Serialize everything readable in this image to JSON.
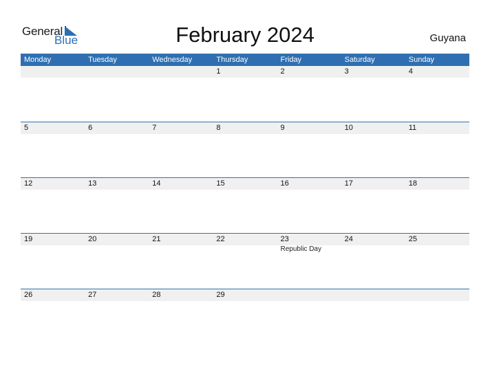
{
  "logo": {
    "line1": "General",
    "line2": "Blue"
  },
  "title": "February 2024",
  "country": "Guyana",
  "weekdays": [
    "Monday",
    "Tuesday",
    "Wednesday",
    "Thursday",
    "Friday",
    "Saturday",
    "Sunday"
  ],
  "weeks": [
    {
      "days": [
        {
          "d": "",
          "h": ""
        },
        {
          "d": "",
          "h": ""
        },
        {
          "d": "",
          "h": ""
        },
        {
          "d": "1",
          "h": ""
        },
        {
          "d": "2",
          "h": ""
        },
        {
          "d": "3",
          "h": ""
        },
        {
          "d": "4",
          "h": ""
        }
      ]
    },
    {
      "days": [
        {
          "d": "5",
          "h": ""
        },
        {
          "d": "6",
          "h": ""
        },
        {
          "d": "7",
          "h": ""
        },
        {
          "d": "8",
          "h": ""
        },
        {
          "d": "9",
          "h": ""
        },
        {
          "d": "10",
          "h": ""
        },
        {
          "d": "11",
          "h": ""
        }
      ]
    },
    {
      "days": [
        {
          "d": "12",
          "h": ""
        },
        {
          "d": "13",
          "h": ""
        },
        {
          "d": "14",
          "h": ""
        },
        {
          "d": "15",
          "h": ""
        },
        {
          "d": "16",
          "h": ""
        },
        {
          "d": "17",
          "h": ""
        },
        {
          "d": "18",
          "h": ""
        }
      ]
    },
    {
      "days": [
        {
          "d": "19",
          "h": ""
        },
        {
          "d": "20",
          "h": ""
        },
        {
          "d": "21",
          "h": ""
        },
        {
          "d": "22",
          "h": ""
        },
        {
          "d": "23",
          "h": "Republic Day"
        },
        {
          "d": "24",
          "h": ""
        },
        {
          "d": "25",
          "h": ""
        }
      ]
    },
    {
      "days": [
        {
          "d": "26",
          "h": ""
        },
        {
          "d": "27",
          "h": ""
        },
        {
          "d": "28",
          "h": ""
        },
        {
          "d": "29",
          "h": ""
        },
        {
          "d": "",
          "h": ""
        },
        {
          "d": "",
          "h": ""
        },
        {
          "d": "",
          "h": ""
        }
      ]
    }
  ],
  "colors": {
    "accent": "#2f6fb1",
    "band": "#f0f0f0"
  }
}
